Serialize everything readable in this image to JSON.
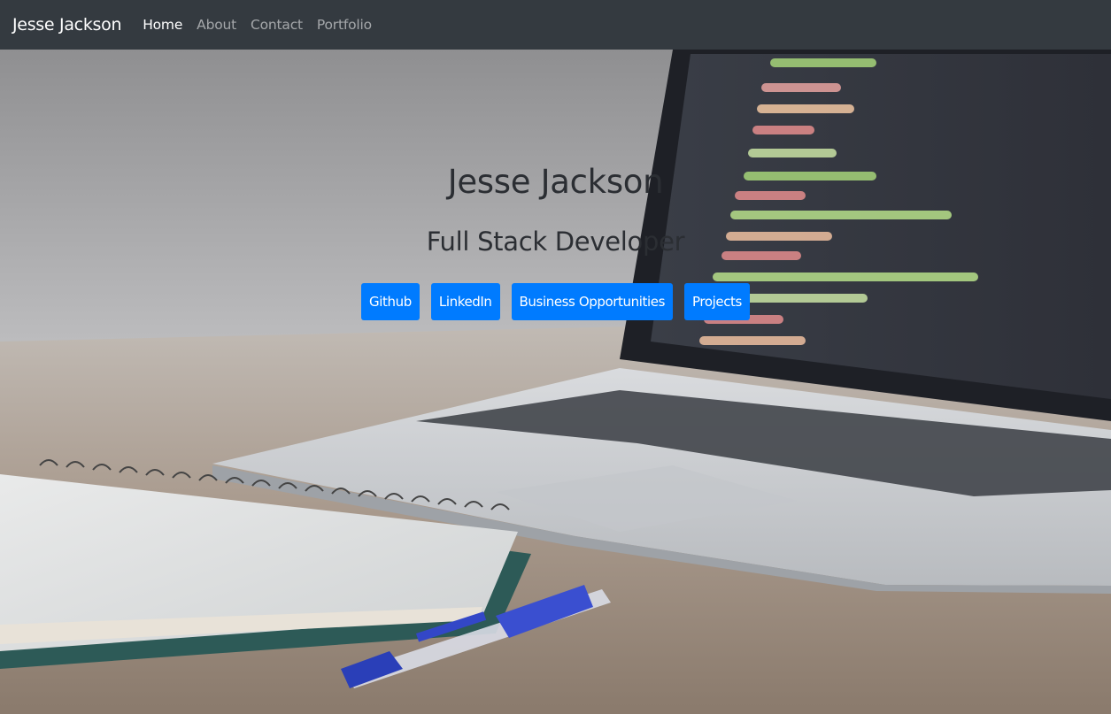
{
  "navbar": {
    "brand": "Jesse Jackson",
    "links": [
      "Home",
      "About",
      "Contact",
      "Portfolio"
    ],
    "active": "Home"
  },
  "hero": {
    "title": "Jesse Jackson",
    "subtitle": "Full Stack Developer",
    "buttons": [
      "Github",
      "LinkedIn",
      "Business Opportunities",
      "Projects"
    ]
  },
  "colors": {
    "navbar_bg": "#343a40",
    "button_bg": "#007bff",
    "heading_text": "#2b2e33"
  }
}
